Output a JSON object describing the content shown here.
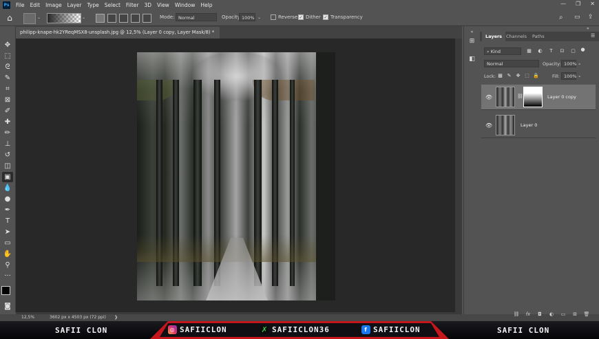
{
  "menu": {
    "items": [
      "File",
      "Edit",
      "Image",
      "Layer",
      "Type",
      "Select",
      "Filter",
      "3D",
      "View",
      "Window",
      "Help"
    ],
    "logo": "Ps"
  },
  "window_controls": [
    "—",
    "❐",
    "✕"
  ],
  "options": {
    "mode_label": "Mode:",
    "mode_value": "Normal",
    "opacity_label": "Opacity:",
    "opacity_value": "100%",
    "reverse_label": "Reverse",
    "dither_label": "Dither",
    "transparency_label": "Transparency"
  },
  "document": {
    "tab_title": "philipp-knape-hk2YReqMSX8-unsplash.jpg @ 12,5% (Layer 0 copy, Layer Mask/8) *"
  },
  "status": {
    "zoom": "12,5%",
    "dimensions": "3602 px x 4503 px (72 ppi)",
    "arrow": "❯"
  },
  "panel": {
    "tabs": [
      "Layers",
      "Channels",
      "Paths"
    ],
    "kind_label": "Kind",
    "blend_mode": "Normal",
    "opacity_label": "Opacity:",
    "opacity_value": "100%",
    "lock_label": "Lock:",
    "fill_label": "Fill:",
    "fill_value": "100%",
    "layers": [
      {
        "name": "Layer 0 copy",
        "selected": true,
        "has_mask": true
      },
      {
        "name": "Layer 0",
        "selected": false,
        "has_mask": false
      }
    ],
    "footer_icons": [
      "link-icon",
      "fx-icon",
      "mask-icon",
      "adjustment-icon",
      "group-icon",
      "new-layer-icon",
      "trash-icon"
    ]
  },
  "banner": {
    "left_name": "SAFII CLON",
    "instagram": "SAFIICLON",
    "fiverr": "SAFIICLON36",
    "facebook": "SAFIICLON",
    "right_name": "SAFII CLON",
    "accent_color": "#c4161c"
  }
}
